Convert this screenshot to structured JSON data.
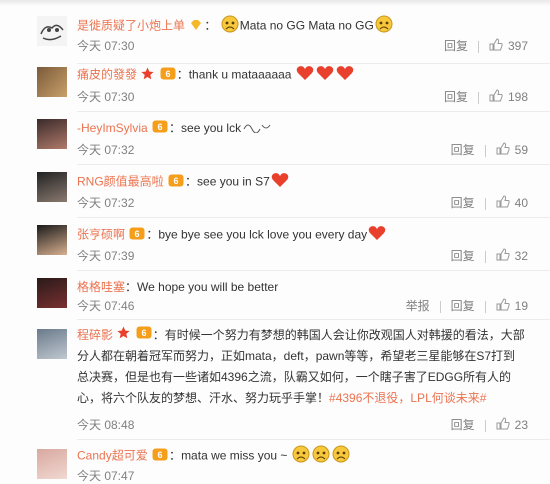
{
  "comments": [
    {
      "user": "是徙质疑了小炮上单",
      "text": "Mata no GG Mata no GG",
      "time": "今天 07:30",
      "reply": "回复",
      "likes": "397"
    },
    {
      "user": "痛皮的發發",
      "text": "thank u mataaaaaa",
      "time": "今天 07:30",
      "reply": "回复",
      "likes": "198"
    },
    {
      "user": "-HeyImSylvia",
      "text": "see you lck",
      "time": "今天 07:32",
      "reply": "回复",
      "likes": "59"
    },
    {
      "user": "RNG颜值最高啦",
      "text": "see you in S7",
      "time": "今天 07:32",
      "reply": "回复",
      "likes": "40"
    },
    {
      "user": "张亨硕啊",
      "text": "bye bye see you lck love you every day",
      "time": "今天 07:39",
      "reply": "回复",
      "likes": "32"
    },
    {
      "user": "格格哇塞",
      "text": "We hope you will be better",
      "time": "今天 07:46",
      "report": "举报",
      "reply": "回复",
      "likes": "19"
    },
    {
      "user": "程碎影",
      "text": "有时候一个努力有梦想的韩国人会让你改观国人对韩援的看法，大部分人都在朝着冠军而努力，正如mata，deft，pawn等等，希望老三星能够在S7打到总决赛，但是也有一些诸如4396之流，队霸又如何，一个瞎子害了EDGG所有人的心，将六个队友的梦想、汗水、努力玩乎手掌！",
      "hashtag": "#4396不退役，LPL何谈未来#",
      "time": "今天 08:48",
      "reply": "回复",
      "likes": "23"
    },
    {
      "user": "Candy超可爱",
      "text": "mata we miss you ~",
      "time": "今天 07:47"
    }
  ],
  "colors": {
    "username": "#eb7350",
    "meta": "#808080",
    "divider": "#ececec"
  }
}
